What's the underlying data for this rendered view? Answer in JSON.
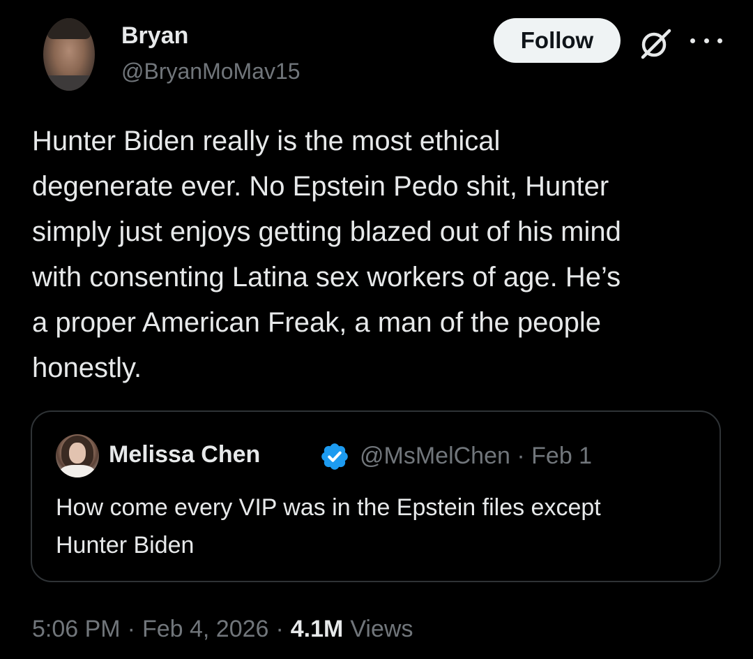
{
  "author": {
    "display_name": "Bryan",
    "handle": "@BryanMoMav15",
    "follow_label": "Follow"
  },
  "post": {
    "text": "Hunter Biden really is the most ethical\ndegenerate ever. No Epstein Pedo shit, Hunter\nsimply just enjoys getting blazed out of his mind\nwith consenting Latina sex workers of age. He’s\na proper American Freak, a man of the people\nhonestly."
  },
  "quote": {
    "display_name": "Melissa Chen",
    "handle": "@MsMelChen",
    "separator": "·",
    "date": "Feb 1",
    "text": "How come every VIP was in the Epstein files except\nHunter Biden",
    "verified": true
  },
  "footer": {
    "time": "5:06 PM",
    "separator": "·",
    "date": "Feb 4, 2026",
    "views_count": "4.1M",
    "views_label": "Views"
  },
  "colors": {
    "background": "#000000",
    "text_primary": "#e7e9ea",
    "text_secondary": "#71767b",
    "border": "#2f3336",
    "verified_blue": "#1d9bf0",
    "follow_bg": "#eff3f4"
  },
  "icons": {
    "grok": "grok-icon",
    "more": "more-icon",
    "verified": "verified-badge-icon"
  }
}
